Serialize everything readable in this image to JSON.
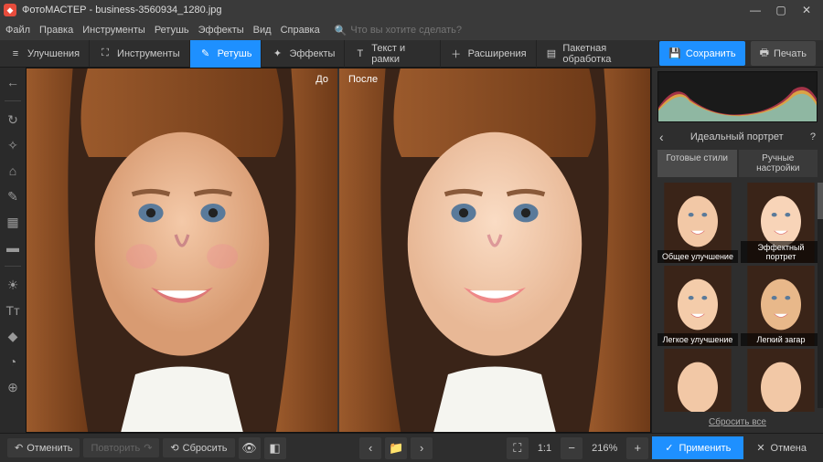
{
  "window": {
    "app_name": "ФотоМАСТЕР",
    "filename": "business-3560934_1280.jpg",
    "full_title": "ФотоМАСТЕР - business-3560934_1280.jpg"
  },
  "menu": {
    "file": "Файл",
    "edit": "Правка",
    "tools_menu": "Инструменты",
    "retouch_menu": "Ретушь",
    "effects_menu": "Эффекты",
    "view": "Вид",
    "help": "Справка",
    "search_placeholder": "Что вы хотите сделать?"
  },
  "toolbar": {
    "enhance": "Улучшения",
    "tools": "Инструменты",
    "retouch": "Ретушь",
    "effects": "Эффекты",
    "text_frames": "Текст и рамки",
    "extensions": "Расширения",
    "batch": "Пакетная обработка",
    "save": "Сохранить",
    "print": "Печать"
  },
  "canvas": {
    "before": "До",
    "after": "После"
  },
  "panel": {
    "title": "Идеальный портрет",
    "tabs": {
      "preset": "Готовые стили",
      "manual": "Ручные настройки"
    },
    "presets": [
      "Общее улучшение",
      "Эффектный портрет",
      "Легкое улучшение",
      "Легкий загар",
      "",
      ""
    ],
    "reset_all": "Сбросить все"
  },
  "bottom": {
    "undo": "Отменить",
    "redo": "Повторить",
    "reset": "Сбросить",
    "zoom": "216%",
    "ratio": "1:1",
    "apply": "Применить",
    "cancel": "Отмена"
  },
  "colors": {
    "accent": "#1e90ff",
    "bg": "#2a2a2a"
  }
}
